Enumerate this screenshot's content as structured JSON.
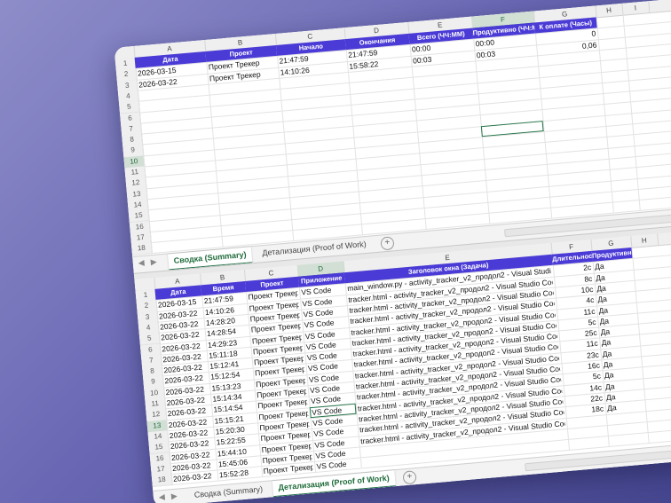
{
  "top_sheet": {
    "columns": [
      "A",
      "B",
      "C",
      "D",
      "E",
      "F",
      "G",
      "H",
      "I"
    ],
    "selected_column": "F",
    "rows": [
      "1",
      "2",
      "3",
      "4",
      "5",
      "6",
      "7",
      "8",
      "9",
      "10",
      "11",
      "12",
      "13",
      "14",
      "15",
      "16",
      "17",
      "18"
    ],
    "selected_row": "10",
    "header": [
      "Дата",
      "Проект",
      "Начало",
      "Окончания",
      "Всего (ЧЧ:ММ)",
      "Продуктивно (ЧЧ:ММ)",
      "К оплате (Часы)"
    ],
    "data": [
      [
        "2026-03-15",
        "Проект Трекер",
        "21:47:59",
        "21:47:59",
        "00:00",
        "00:00",
        "0"
      ],
      [
        "2026-03-22",
        "Проект Трекер",
        "14:10:26",
        "15:58:22",
        "00:03",
        "00:03",
        "0,06"
      ]
    ]
  },
  "top_tabs": {
    "nav_prev": "◀",
    "nav_next": "▶",
    "tabs": [
      "Сводка (Summary)",
      "Детализация (Proof of Work)"
    ],
    "active": 0,
    "add_label": "+"
  },
  "bottom_sheet": {
    "columns": [
      "A",
      "B",
      "C",
      "D",
      "E",
      "F",
      "G",
      "H"
    ],
    "selected_column": "D",
    "rows": [
      "1",
      "2",
      "3",
      "4",
      "5",
      "6",
      "7",
      "8",
      "9",
      "10",
      "11",
      "12",
      "13",
      "14",
      "15",
      "16",
      "17",
      "18"
    ],
    "selected_row": "13",
    "header": [
      "Дата",
      "Время",
      "Проект",
      "Приложение",
      "Заголовок окна (Задача)",
      "Длительность",
      "Продуктивно"
    ],
    "data": [
      [
        "2026-03-15",
        "21:47:59",
        "Проект Трекер",
        "VS Code",
        "main_window.py - activity_tracker_v2_продол2 - Visual Studi",
        "2с",
        "Да"
      ],
      [
        "2026-03-22",
        "14:10:26",
        "Проект Трекер",
        "VS Code",
        "tracker.html - activity_tracker_v2_продол2 - Visual Studio Coc",
        "8с",
        "Да"
      ],
      [
        "2026-03-22",
        "14:28:20",
        "Проект Трекер",
        "VS Code",
        "tracker.html - activity_tracker_v2_продол2 - Visual Studio Coc",
        "10с",
        "Да"
      ],
      [
        "2026-03-22",
        "14:28:54",
        "Проект Трекер",
        "VS Code",
        "tracker.html - activity_tracker_v2_продол2 - Visual Studio Coc",
        "4с",
        "Да"
      ],
      [
        "2026-03-22",
        "14:29:23",
        "Проект Трекер",
        "VS Code",
        "tracker.html - activity_tracker_v2_продол2 - Visual Studio Coc",
        "11с",
        "Да"
      ],
      [
        "2026-03-22",
        "15:11:18",
        "Проект Трекер",
        "VS Code",
        "tracker.html - activity_tracker_v2_продол2 - Visual Studio Coc",
        "5с",
        "Да"
      ],
      [
        "2026-03-22",
        "15:12:41",
        "Проект Трекер",
        "VS Code",
        "tracker.html - activity_tracker_v2_продол2 - Visual Studio Coc",
        "25с",
        "Да"
      ],
      [
        "2026-03-22",
        "15:12:54",
        "Проект Трекер",
        "VS Code",
        "tracker.html - activity_tracker_v2_продол2 - Visual Studio Coc",
        "11с",
        "Да"
      ],
      [
        "2026-03-22",
        "15:13:23",
        "Проект Трекер",
        "VS Code",
        "tracker.html - activity_tracker_v2_продол2 - Visual Studio Coc",
        "23с",
        "Да"
      ],
      [
        "2026-03-22",
        "15:14:34",
        "Проект Трекер",
        "VS Code",
        "tracker.html - activity_tracker_v2_продол2 - Visual Studio Coc",
        "16с",
        "Да"
      ],
      [
        "2026-03-22",
        "15:14:54",
        "Проект Трекер",
        "VS Code",
        "tracker.html - activity_tracker_v2_продол2 - Visual Studio Coc",
        "5с",
        "Да"
      ],
      [
        "2026-03-22",
        "15:15:21",
        "Проект Трекер",
        "VS Code",
        "tracker.html - activity_tracker_v2_продол2 - Visual Studio Coc",
        "14с",
        "Да"
      ],
      [
        "2026-03-22",
        "15:20:30",
        "Проект Трекер",
        "VS Code",
        "tracker.html - activity_tracker_v2_продол2 - Visual Studio Coc",
        "22с",
        "Да"
      ],
      [
        "2026-03-22",
        "15:22:55",
        "Проект Трекер",
        "VS Code",
        "tracker.html - activity_tracker_v2_продол2 - Visual Studio Coc",
        "18с",
        "Да"
      ],
      [
        "2026-03-22",
        "15:44:10",
        "Проект Трекер",
        "VS Code",
        "tracker.html - activity_tracker_v2_продол2 - Visual Studio Coc",
        "",
        ""
      ],
      [
        "2026-03-22",
        "15:45:06",
        "Проект Трекер",
        "VS Code",
        "",
        "",
        ""
      ],
      [
        "2026-03-22",
        "15:52:28",
        "Проект Трекер",
        "VS Code",
        "",
        "",
        ""
      ]
    ]
  },
  "bottom_tabs": {
    "nav_prev": "◀",
    "nav_next": "▶",
    "tabs": [
      "Сводка (Summary)",
      "Детализация (Proof of Work)"
    ],
    "active": 1,
    "add_label": "+"
  },
  "colors": {
    "header_fill": "#4b3bd6",
    "header_text": "#ffffff",
    "selection": "#217346",
    "background_top": "#8e8dc9",
    "background_bottom": "#45468f"
  }
}
